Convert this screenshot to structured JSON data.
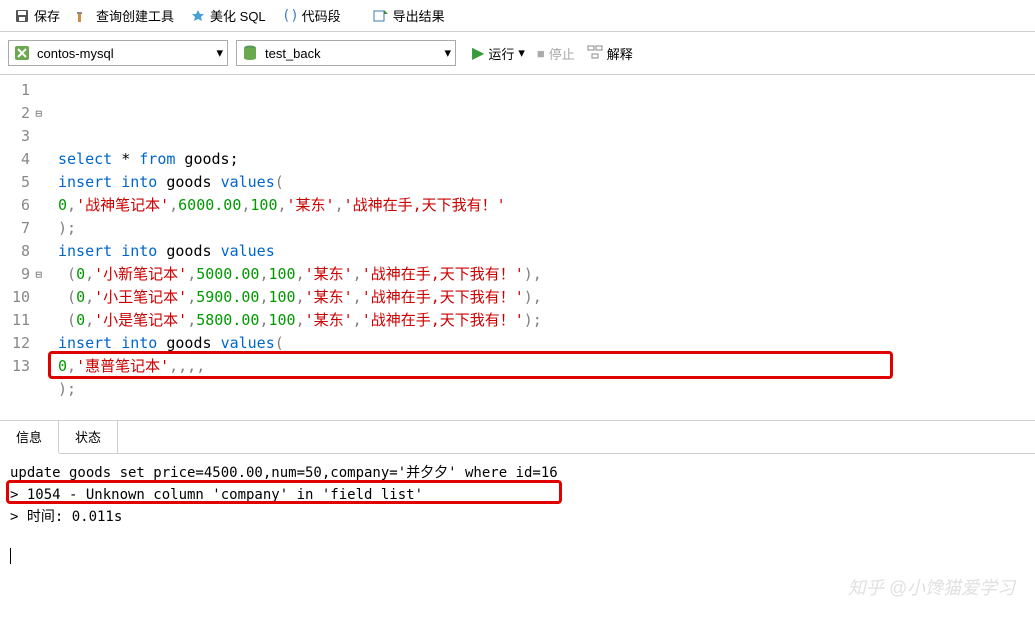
{
  "toolbar": {
    "save": "保存",
    "query_builder": "查询创建工具",
    "beautify_sql": "美化 SQL",
    "code_snippet": "代码段",
    "export_result": "导出结果"
  },
  "connection": {
    "server": "contos-mysql",
    "database": "test_back"
  },
  "actions": {
    "run": "运行",
    "stop": "停止",
    "explain": "解释"
  },
  "code_lines": [
    {
      "num": 1,
      "fold": "",
      "tokens": [
        {
          "t": "kw",
          "v": "select"
        },
        {
          "t": "plain",
          "v": " * "
        },
        {
          "t": "kw",
          "v": "from"
        },
        {
          "t": "plain",
          "v": " goods;"
        }
      ]
    },
    {
      "num": 2,
      "fold": "⊟",
      "tokens": [
        {
          "t": "kw",
          "v": "insert"
        },
        {
          "t": "plain",
          "v": " "
        },
        {
          "t": "kw",
          "v": "into"
        },
        {
          "t": "plain",
          "v": " goods "
        },
        {
          "t": "kw",
          "v": "values"
        },
        {
          "t": "sym",
          "v": "("
        }
      ]
    },
    {
      "num": 3,
      "fold": "",
      "tokens": [
        {
          "t": "num",
          "v": "0"
        },
        {
          "t": "sym",
          "v": ","
        },
        {
          "t": "str",
          "v": "'战神笔记本'"
        },
        {
          "t": "sym",
          "v": ","
        },
        {
          "t": "num",
          "v": "6000.00"
        },
        {
          "t": "sym",
          "v": ","
        },
        {
          "t": "num",
          "v": "100"
        },
        {
          "t": "sym",
          "v": ","
        },
        {
          "t": "str",
          "v": "'某东'"
        },
        {
          "t": "sym",
          "v": ","
        },
        {
          "t": "str",
          "v": "'战神在手,天下我有！'"
        }
      ]
    },
    {
      "num": 4,
      "fold": "",
      "tokens": [
        {
          "t": "sym",
          "v": ");"
        }
      ]
    },
    {
      "num": 5,
      "fold": "",
      "tokens": [
        {
          "t": "kw",
          "v": "insert"
        },
        {
          "t": "plain",
          "v": " "
        },
        {
          "t": "kw",
          "v": "into"
        },
        {
          "t": "plain",
          "v": " goods "
        },
        {
          "t": "kw",
          "v": "values"
        }
      ]
    },
    {
      "num": 6,
      "fold": "",
      "tokens": [
        {
          "t": "sym",
          "v": " ("
        },
        {
          "t": "num",
          "v": "0"
        },
        {
          "t": "sym",
          "v": ","
        },
        {
          "t": "str",
          "v": "'小新笔记本'"
        },
        {
          "t": "sym",
          "v": ","
        },
        {
          "t": "num",
          "v": "5000.00"
        },
        {
          "t": "sym",
          "v": ","
        },
        {
          "t": "num",
          "v": "100"
        },
        {
          "t": "sym",
          "v": ","
        },
        {
          "t": "str",
          "v": "'某东'"
        },
        {
          "t": "sym",
          "v": ","
        },
        {
          "t": "str",
          "v": "'战神在手,天下我有！'"
        },
        {
          "t": "sym",
          "v": "),"
        }
      ]
    },
    {
      "num": 7,
      "fold": "",
      "tokens": [
        {
          "t": "sym",
          "v": " ("
        },
        {
          "t": "num",
          "v": "0"
        },
        {
          "t": "sym",
          "v": ","
        },
        {
          "t": "str",
          "v": "'小王笔记本'"
        },
        {
          "t": "sym",
          "v": ","
        },
        {
          "t": "num",
          "v": "5900.00"
        },
        {
          "t": "sym",
          "v": ","
        },
        {
          "t": "num",
          "v": "100"
        },
        {
          "t": "sym",
          "v": ","
        },
        {
          "t": "str",
          "v": "'某东'"
        },
        {
          "t": "sym",
          "v": ","
        },
        {
          "t": "str",
          "v": "'战神在手,天下我有！'"
        },
        {
          "t": "sym",
          "v": "),"
        }
      ]
    },
    {
      "num": 8,
      "fold": "",
      "tokens": [
        {
          "t": "sym",
          "v": " ("
        },
        {
          "t": "num",
          "v": "0"
        },
        {
          "t": "sym",
          "v": ","
        },
        {
          "t": "str",
          "v": "'小是笔记本'"
        },
        {
          "t": "sym",
          "v": ","
        },
        {
          "t": "num",
          "v": "5800.00"
        },
        {
          "t": "sym",
          "v": ","
        },
        {
          "t": "num",
          "v": "100"
        },
        {
          "t": "sym",
          "v": ","
        },
        {
          "t": "str",
          "v": "'某东'"
        },
        {
          "t": "sym",
          "v": ","
        },
        {
          "t": "str",
          "v": "'战神在手,天下我有！'"
        },
        {
          "t": "sym",
          "v": ");"
        }
      ]
    },
    {
      "num": 9,
      "fold": "⊟",
      "tokens": [
        {
          "t": "kw",
          "v": "insert"
        },
        {
          "t": "plain",
          "v": " "
        },
        {
          "t": "kw",
          "v": "into"
        },
        {
          "t": "plain",
          "v": " goods "
        },
        {
          "t": "kw",
          "v": "values"
        },
        {
          "t": "sym",
          "v": "("
        }
      ]
    },
    {
      "num": 10,
      "fold": "",
      "tokens": [
        {
          "t": "num",
          "v": "0"
        },
        {
          "t": "sym",
          "v": ","
        },
        {
          "t": "str",
          "v": "'惠普笔记本'"
        },
        {
          "t": "sym",
          "v": ",,,,"
        }
      ]
    },
    {
      "num": 11,
      "fold": "",
      "tokens": [
        {
          "t": "sym",
          "v": ");"
        }
      ]
    },
    {
      "num": 12,
      "fold": "",
      "tokens": []
    },
    {
      "num": 13,
      "fold": "",
      "tokens": [
        {
          "t": "kw",
          "v": "update"
        },
        {
          "t": "plain",
          "v": " goods "
        },
        {
          "t": "kw",
          "v": "set"
        },
        {
          "t": "plain",
          "v": " price="
        },
        {
          "t": "num",
          "v": "4500.00"
        },
        {
          "t": "plain",
          "v": ",num="
        },
        {
          "t": "num",
          "v": "50"
        },
        {
          "t": "plain",
          "v": ",company="
        },
        {
          "t": "str",
          "v": "'并夕夕'"
        },
        {
          "t": "plain",
          "v": " "
        },
        {
          "t": "kw",
          "v": "where"
        },
        {
          "t": "plain",
          "v": " id="
        },
        {
          "t": "num",
          "v": "16"
        },
        {
          "t": "plain",
          "v": ";"
        }
      ]
    }
  ],
  "tabs": {
    "info": "信息",
    "status": "状态"
  },
  "output": {
    "line1": "update goods set price=4500.00,num=50,company='并夕夕' where id=16",
    "line2": "> 1054 - Unknown column 'company' in 'field list'",
    "line3": "> 时间: 0.011s"
  },
  "watermark": "知乎 @小馋猫爱学习"
}
